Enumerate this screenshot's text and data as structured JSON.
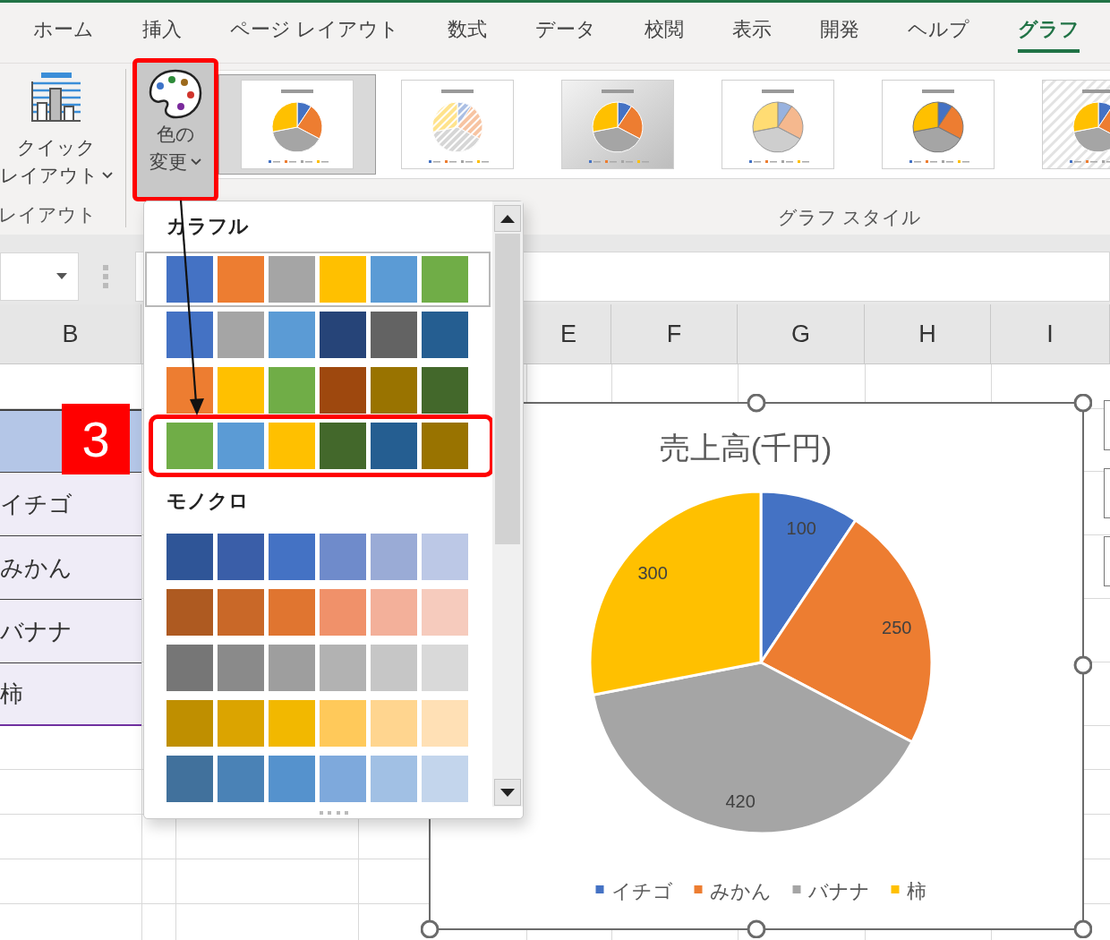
{
  "ribbon_tabs": [
    {
      "label": "ホーム",
      "selected": false
    },
    {
      "label": "挿入",
      "selected": false
    },
    {
      "label": "ページ レイアウト",
      "selected": false
    },
    {
      "label": "数式",
      "selected": false
    },
    {
      "label": "データ",
      "selected": false
    },
    {
      "label": "校閲",
      "selected": false
    },
    {
      "label": "表示",
      "selected": false
    },
    {
      "label": "開発",
      "selected": false
    },
    {
      "label": "ヘルプ",
      "selected": false
    },
    {
      "label": "グラフ",
      "selected": true
    }
  ],
  "ribbon": {
    "quick_layout_button": {
      "lines": [
        "クイック",
        "レイアウト"
      ]
    },
    "layout_group_label": "レイアウト",
    "change_colors_button": {
      "lines": [
        "色の",
        "変更"
      ],
      "expanded": true,
      "annotated": true
    },
    "chart_styles": [
      {
        "kind": "plain",
        "selected": true
      },
      {
        "kind": "hatched",
        "selected": false
      },
      {
        "kind": "shaded",
        "selected": false
      },
      {
        "kind": "pastel",
        "selected": false
      },
      {
        "kind": "beveled",
        "selected": false
      },
      {
        "kind": "striped",
        "selected": false
      }
    ],
    "styles_group_label": "グラフ スタイル"
  },
  "sheet": {
    "columns": [
      "B",
      "E",
      "F",
      "G",
      "H",
      "I"
    ],
    "table_rows": [
      "イチゴ",
      "みかん",
      "バナナ",
      "柿"
    ]
  },
  "color_menu": {
    "sections": [
      {
        "title": "カラフル",
        "palettes": [
          {
            "selected": true,
            "annotated": false,
            "swatches": [
              {
                "color": "#4472c4"
              },
              {
                "color": "#ed7d31"
              },
              {
                "color": "#a5a5a5"
              },
              {
                "color": "#ffc000"
              },
              {
                "color": "#5b9bd5"
              },
              {
                "color": "#70ad47"
              }
            ]
          },
          {
            "selected": false,
            "annotated": false,
            "swatches": [
              {
                "color": "#4472c4"
              },
              {
                "color": "#a5a5a5"
              },
              {
                "color": "#5b9bd5"
              },
              {
                "color": "#264478"
              },
              {
                "color": "#636363"
              },
              {
                "color": "#255e91"
              }
            ]
          },
          {
            "selected": false,
            "annotated": false,
            "swatches": [
              {
                "color": "#ed7d31"
              },
              {
                "color": "#ffc000"
              },
              {
                "color": "#70ad47"
              },
              {
                "color": "#9e480e"
              },
              {
                "color": "#997300"
              },
              {
                "color": "#43682b"
              }
            ]
          },
          {
            "selected": false,
            "annotated": true,
            "swatches": [
              {
                "color": "#70ad47"
              },
              {
                "color": "#5b9bd5"
              },
              {
                "color": "#ffc000"
              },
              {
                "color": "#43682b"
              },
              {
                "color": "#255e91"
              },
              {
                "color": "#997300"
              }
            ]
          }
        ]
      },
      {
        "title": "モノクロ",
        "palettes": [
          {
            "selected": false,
            "annotated": false,
            "swatches": [
              {
                "color": "#2f5597"
              },
              {
                "color": "#3a5ea8"
              },
              {
                "color": "#4472c4"
              },
              {
                "color": "#6f8bcb"
              },
              {
                "color": "#9aabd6"
              },
              {
                "color": "#bcc8e6"
              }
            ]
          },
          {
            "selected": false,
            "annotated": false,
            "swatches": [
              {
                "color": "#ae5a21"
              },
              {
                "color": "#c96828"
              },
              {
                "color": "#e07530"
              },
              {
                "color": "#f0916a"
              },
              {
                "color": "#f3b09a"
              },
              {
                "color": "#f6cbbd"
              }
            ]
          },
          {
            "selected": false,
            "annotated": false,
            "swatches": [
              {
                "color": "#767676"
              },
              {
                "color": "#8a8a8a"
              },
              {
                "color": "#9e9e9e"
              },
              {
                "color": "#b2b2b2"
              },
              {
                "color": "#c6c6c6"
              },
              {
                "color": "#d9d9d9"
              }
            ]
          },
          {
            "selected": false,
            "annotated": false,
            "swatches": [
              {
                "color": "#bf8f00"
              },
              {
                "color": "#dba400"
              },
              {
                "color": "#f2b800"
              },
              {
                "color": "#ffc95a"
              },
              {
                "color": "#ffd58f"
              },
              {
                "color": "#ffe0b5"
              }
            ]
          },
          {
            "selected": false,
            "annotated": false,
            "swatches": [
              {
                "color": "#41719c"
              },
              {
                "color": "#4a82b6"
              },
              {
                "color": "#5592cd"
              },
              {
                "color": "#7ea9dc"
              },
              {
                "color": "#a1c0e4"
              },
              {
                "color": "#c3d5ec"
              }
            ]
          }
        ]
      }
    ]
  },
  "annotation": {
    "step_badge": "3"
  },
  "chart": {
    "chart_data": {
      "type": "pie",
      "title": "売上高(千円)",
      "categories": [
        "イチゴ",
        "みかん",
        "バナナ",
        "柿"
      ],
      "values": [
        100,
        250,
        420,
        300
      ],
      "data_labels": true,
      "legend": "bottom"
    }
  }
}
